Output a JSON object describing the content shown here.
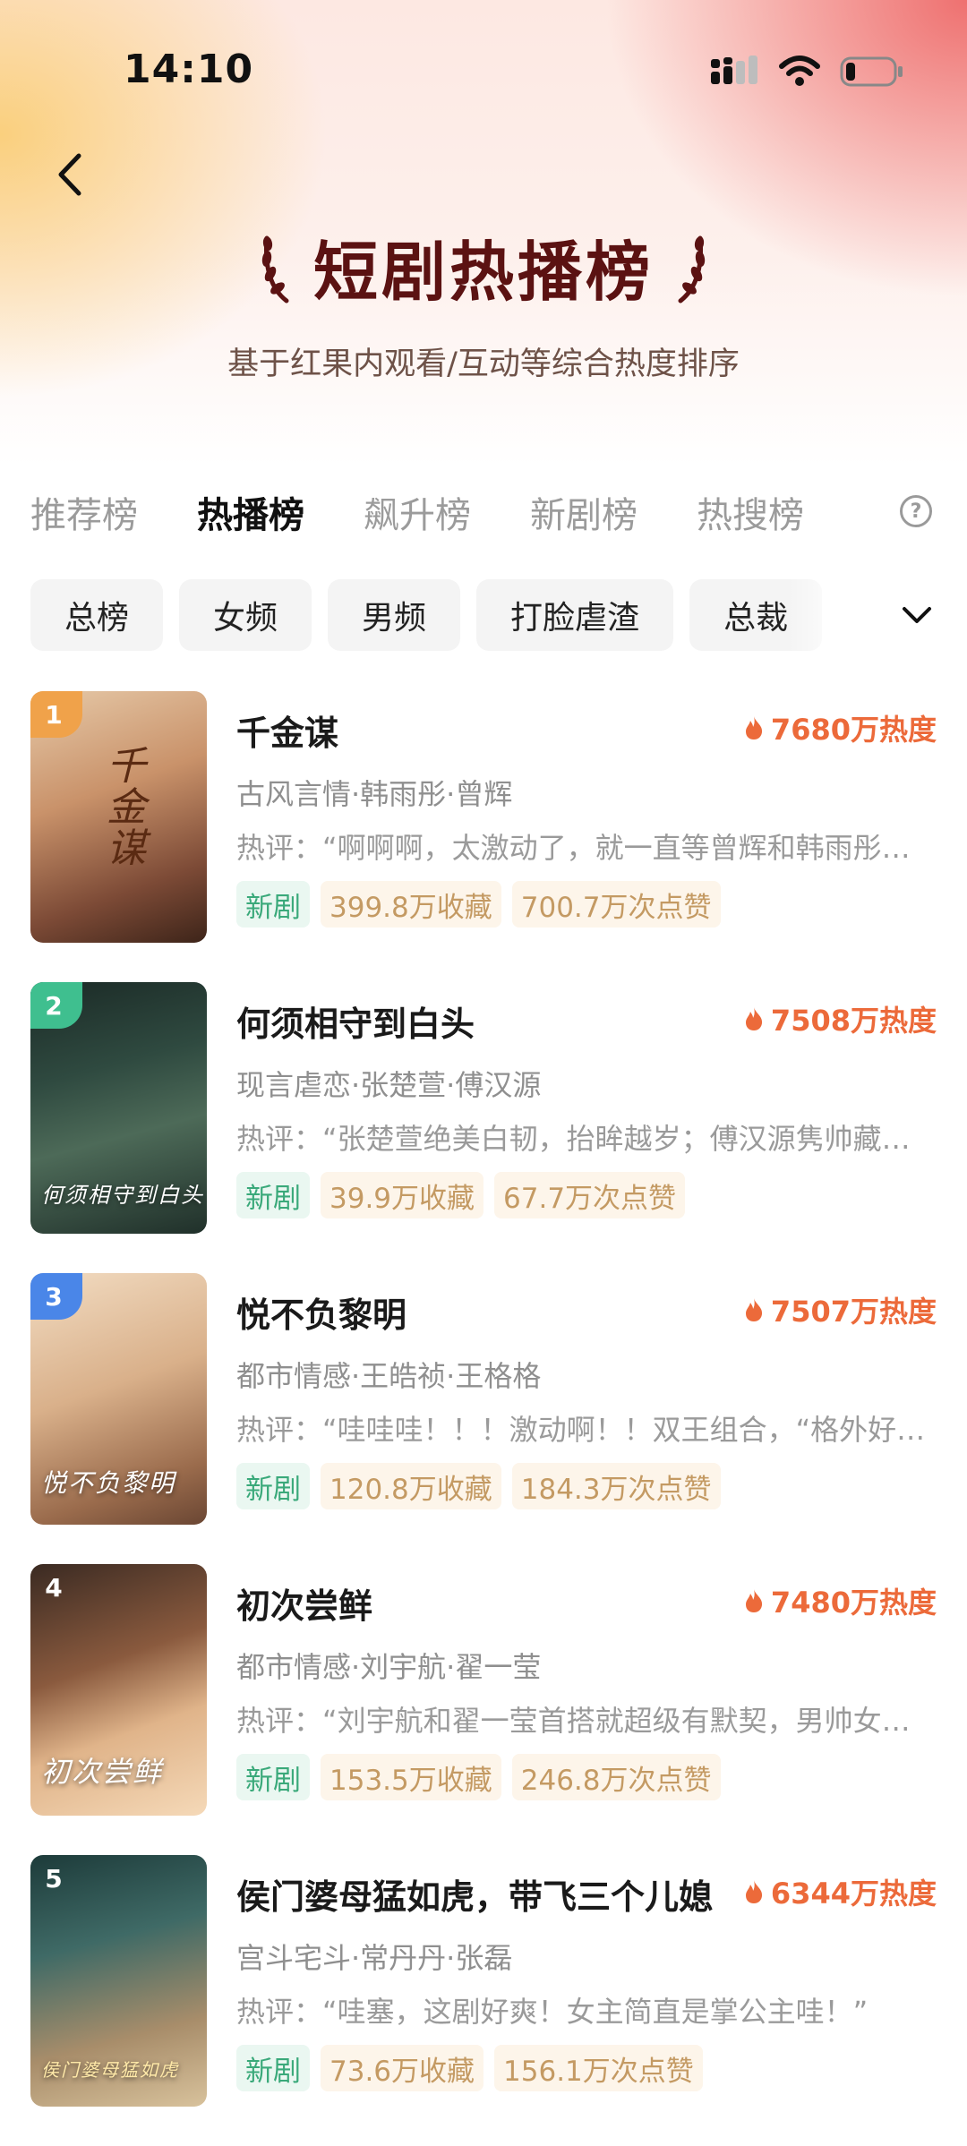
{
  "status_bar": {
    "time": "14:10"
  },
  "header": {
    "title": "短剧热播榜",
    "subtitle": "基于红果内观看/互动等综合热度排序"
  },
  "tabs": [
    {
      "label": "推荐榜",
      "active": false
    },
    {
      "label": "热播榜",
      "active": true
    },
    {
      "label": "飙升榜",
      "active": false
    },
    {
      "label": "新剧榜",
      "active": false
    },
    {
      "label": "热搜榜",
      "active": false
    }
  ],
  "chips": [
    {
      "label": "总榜"
    },
    {
      "label": "女频"
    },
    {
      "label": "男频"
    },
    {
      "label": "打脸虐渣"
    },
    {
      "label": "总裁"
    }
  ],
  "items": [
    {
      "rank": "1",
      "rank_color": "#f0a24a",
      "title": "千金谋",
      "heat": "7680万热度",
      "tags": "古风言情·韩雨彤·曾辉",
      "review": "热评：“啊啊啊，太激动了，就一直等曾辉和韩雨彤合作的新剧了！”",
      "badge_new": "新剧",
      "favorites": "399.8万收藏",
      "likes": "700.7万次点赞",
      "poster_text": "千金谋"
    },
    {
      "rank": "2",
      "rank_color": "#3fbf8f",
      "title": "何须相守到白头",
      "heat": "7508万热度",
      "tags": "现言虐恋·张楚萱·傅汉源",
      "review": "热评：“张楚萱绝美白韧，抬眸越岁；傅汉源隽帅藏锋，少年意气”",
      "badge_new": "新剧",
      "favorites": "39.9万收藏",
      "likes": "67.7万次点赞",
      "poster_text": "何须相守到白头"
    },
    {
      "rank": "3",
      "rank_color": "#4a86e8",
      "title": "悦不负黎明",
      "heat": "7507万热度",
      "tags": "都市情感·王皓祯·王格格",
      "review": "热评：“哇哇哇！！！激动啊！！双王组合，“格外好看”！”",
      "badge_new": "新剧",
      "favorites": "120.8万收藏",
      "likes": "184.3万次点赞",
      "poster_text": "悦不负黎明"
    },
    {
      "rank": "4",
      "rank_color": "rgba(0,0,0,0)",
      "title": "初次尝鲜",
      "heat": "7480万热度",
      "tags": "都市情感·刘宇航·翟一莹",
      "review": "热评：“刘宇航和翟一莹首搭就超级有默契，男帅女美好嗑死了”",
      "badge_new": "新剧",
      "favorites": "153.5万收藏",
      "likes": "246.8万次点赞",
      "poster_text": "初次尝鲜"
    },
    {
      "rank": "5",
      "rank_color": "rgba(0,0,0,0)",
      "title": "侯门婆母猛如虎，带飞三个儿媳",
      "heat": "6344万热度",
      "tags": "宫斗宅斗·常丹丹·张磊",
      "review": "热评：“哇塞，这剧好爽！女主简直是掌公主哇！”",
      "badge_new": "新剧",
      "favorites": "73.6万收藏",
      "likes": "156.1万次点赞",
      "poster_text": "侯门婆母猛如虎"
    }
  ]
}
